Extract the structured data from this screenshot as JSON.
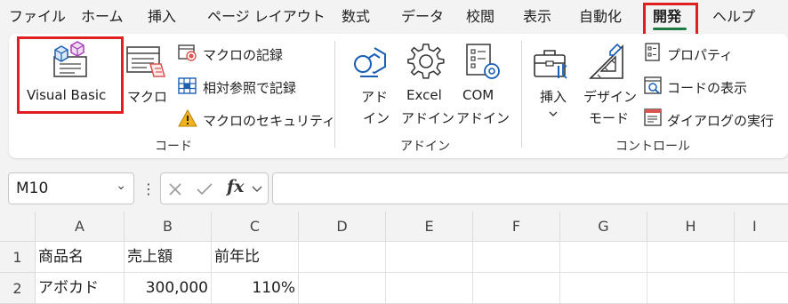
{
  "menu": {
    "tabs": [
      {
        "label": "ファイル"
      },
      {
        "label": "ホーム"
      },
      {
        "label": "挿入"
      },
      {
        "label": "ページ レイアウト"
      },
      {
        "label": "数式"
      },
      {
        "label": "データ"
      },
      {
        "label": "校閲"
      },
      {
        "label": "表示"
      },
      {
        "label": "自動化"
      },
      {
        "label": "開発",
        "active": true
      },
      {
        "label": "ヘルプ"
      }
    ]
  },
  "ribbon": {
    "code": {
      "visual_basic": "Visual Basic",
      "macro": "マクロ",
      "record_macro": "マクロの記録",
      "relative_ref": "相対参照で記録",
      "macro_security": "マクロのセキュリティ",
      "label": "コード"
    },
    "addins": {
      "addins_line1": "アド",
      "addins_line2": "イン",
      "excel_addins_line1": "Excel",
      "excel_addins_line2": "アドイン",
      "com_addins_line1": "COM",
      "com_addins_line2": "アドイン",
      "label": "アドイン"
    },
    "controls": {
      "insert": "挿入",
      "design_mode_line1": "デザイン",
      "design_mode_line2": "モード",
      "properties": "プロパティ",
      "view_code": "コードの表示",
      "run_dialog": "ダイアログの実行",
      "label": "コントロール"
    }
  },
  "formula_bar": {
    "name_box": "M10",
    "fx": "fx",
    "formula": ""
  },
  "sheet": {
    "columns": [
      "A",
      "B",
      "C",
      "D",
      "E",
      "F",
      "G",
      "H",
      "I"
    ],
    "rows": [
      {
        "num": "1",
        "cells": [
          "商品名",
          "売上額",
          "前年比"
        ]
      },
      {
        "num": "2",
        "cells": [
          "アボカド",
          "300,000",
          "110%"
        ]
      }
    ]
  },
  "colors": {
    "highlight": "#e02020",
    "accent_green": "#1e7a45",
    "icon_blue": "#1a5fb4"
  }
}
